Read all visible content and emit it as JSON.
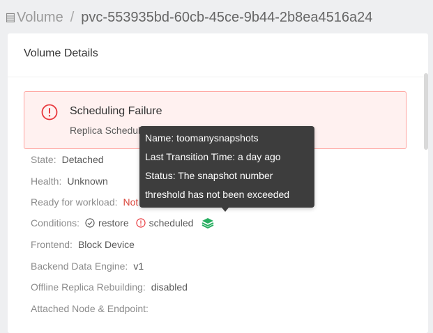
{
  "breadcrumb": {
    "root": "Volume",
    "separator": "/",
    "current": "pvc-553935bd-60cb-45ce-9b44-2b8ea4516a24"
  },
  "card": {
    "title": "Volume Details"
  },
  "alert": {
    "title": "Scheduling Failure",
    "description": "Replica Scheduling Failure",
    "icon": "exclamation-circle-icon",
    "color": "#e8383d"
  },
  "fields": {
    "state": {
      "label": "State:",
      "value": "Detached"
    },
    "health": {
      "label": "Health:",
      "value": "Unknown"
    },
    "ready": {
      "label": "Ready for workload:",
      "value": "Not Ready"
    },
    "conditions": {
      "label": "Conditions:",
      "items": [
        {
          "label": "restore",
          "icon": "check-circle-icon"
        },
        {
          "label": "scheduled",
          "icon": "exclamation-circle-icon"
        }
      ],
      "snapshot_icon": "layers-icon"
    },
    "frontend": {
      "label": "Frontend:",
      "value": "Block Device"
    },
    "engine": {
      "label": "Backend Data Engine:",
      "value": "v1"
    },
    "offline_rebuild": {
      "label": "Offline Replica Rebuilding:",
      "value": "disabled"
    },
    "attached": {
      "label": "Attached Node & Endpoint:",
      "value": ""
    }
  },
  "tooltip": {
    "line1": "Name: toomanysnapshots",
    "line2": "Last Transition Time: a day ago",
    "line3": "Status: The snapshot number",
    "line4": "threshold has not been exceeded"
  },
  "colors": {
    "danger": "#e8383d",
    "success": "#27ae60",
    "tooltip_bg": "#3d3d3d"
  }
}
